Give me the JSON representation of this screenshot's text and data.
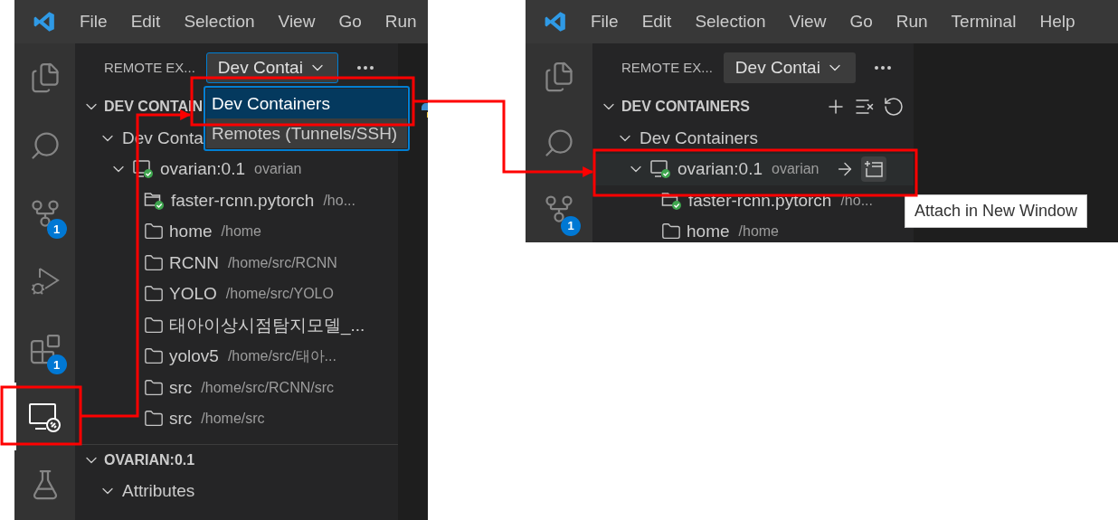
{
  "screenshots": [
    {
      "menu_bar": [
        "File",
        "Edit",
        "Selection",
        "View",
        "Go",
        "Run"
      ],
      "activity_bar": [
        {
          "kind": "explorer",
          "selected": false
        },
        {
          "kind": "search",
          "selected": false
        },
        {
          "kind": "source-control",
          "selected": false,
          "badge": "1"
        },
        {
          "kind": "run-debug",
          "selected": false
        },
        {
          "kind": "extensions",
          "selected": false,
          "badge": "1"
        },
        {
          "kind": "remote",
          "selected": true
        },
        {
          "kind": "testing",
          "selected": false
        }
      ],
      "sidebar": {
        "title": "REMOTE EX...",
        "view_picker": {
          "value": "Dev Contai",
          "open": true,
          "options": [
            {
              "label": "Dev Containers",
              "selected": true
            },
            {
              "label": "Remotes (Tunnels/SSH)",
              "selected": false
            }
          ]
        },
        "sections": [
          {
            "title": "DEV CONTAIN",
            "expanded": true,
            "tree": [
              {
                "label": "Dev Conta",
                "expanded": true,
                "children": [
                  {
                    "kind": "container",
                    "label": "ovarian:0.1",
                    "description": "ovarian",
                    "expanded": true,
                    "children": [
                      {
                        "kind": "folder-check",
                        "label": "faster-rcnn.pytorch",
                        "description": "/ho..."
                      },
                      {
                        "kind": "folder",
                        "label": "home",
                        "description": "/home"
                      },
                      {
                        "kind": "folder",
                        "label": "RCNN",
                        "description": "/home/src/RCNN"
                      },
                      {
                        "kind": "folder",
                        "label": "YOLO",
                        "description": "/home/src/YOLO"
                      },
                      {
                        "kind": "folder",
                        "label": "태아이상시점탐지모델_..."
                      },
                      {
                        "kind": "folder",
                        "label": "yolov5",
                        "description": "/home/src/태아..."
                      },
                      {
                        "kind": "folder",
                        "label": "src",
                        "description": "/home/src/RCNN/src"
                      },
                      {
                        "kind": "folder",
                        "label": "src",
                        "description": "/home/src"
                      }
                    ]
                  }
                ]
              }
            ]
          },
          {
            "title": "OVARIAN:0.1",
            "expanded": true,
            "tree": [
              {
                "label": "Attributes",
                "expanded": true
              }
            ]
          }
        ]
      },
      "editor_tabs": [
        {
          "kind": "python"
        }
      ]
    },
    {
      "menu_bar": [
        "File",
        "Edit",
        "Selection",
        "View",
        "Go",
        "Run",
        "Terminal",
        "Help"
      ],
      "activity_bar": [
        {
          "kind": "explorer",
          "selected": false
        },
        {
          "kind": "search",
          "selected": false
        },
        {
          "kind": "source-control",
          "selected": false,
          "badge": "1"
        }
      ],
      "sidebar": {
        "title": "REMOTE EX...",
        "view_picker": {
          "value": "Dev Contai",
          "open": false
        },
        "sections": [
          {
            "title": "DEV CONTAINERS",
            "expanded": true,
            "actions": [
              {
                "kind": "add"
              },
              {
                "kind": "clear"
              },
              {
                "kind": "refresh"
              }
            ],
            "tree": [
              {
                "label": "Dev Containers",
                "expanded": true,
                "children": [
                  {
                    "kind": "container",
                    "label": "ovarian:0.1",
                    "description": "ovarian",
                    "expanded": true,
                    "hovered": true,
                    "actions": [
                      {
                        "kind": "attach",
                        "hovered": false
                      },
                      {
                        "kind": "new-window",
                        "hovered": true
                      }
                    ],
                    "children": [
                      {
                        "kind": "folder-check",
                        "label": "faster-rcnn.pytorch",
                        "description": "/ho..."
                      },
                      {
                        "kind": "folder",
                        "label": "home",
                        "description": "/home"
                      }
                    ]
                  }
                ]
              }
            ]
          }
        ]
      },
      "tooltip": "Attach in New Window"
    }
  ]
}
